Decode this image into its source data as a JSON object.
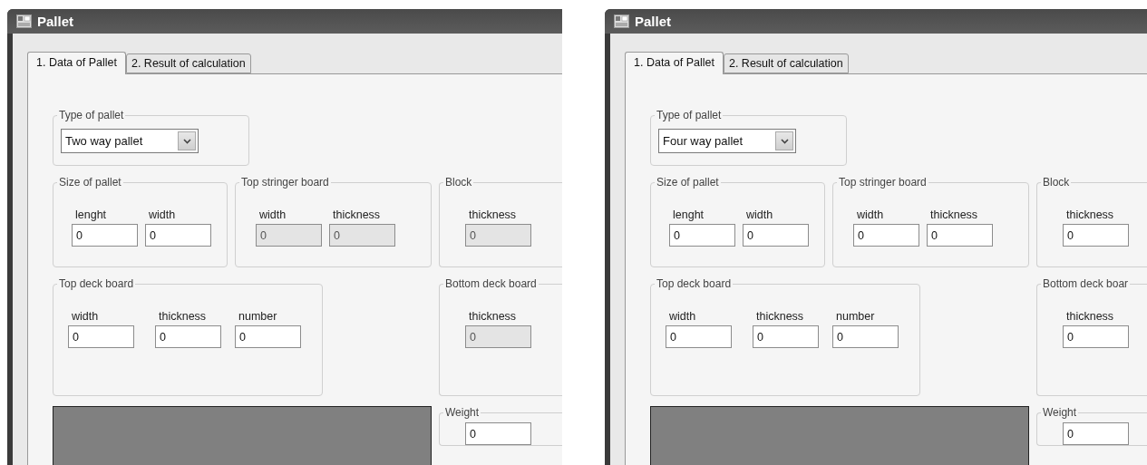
{
  "windows": [
    {
      "title": "Pallet",
      "tabs": [
        {
          "label": "1. Data of Pallet",
          "selected": true
        },
        {
          "label": "2. Result of calculation",
          "selected": false
        }
      ],
      "type_of_pallet": {
        "title": "Type of pallet",
        "value": "Two way pallet"
      },
      "size_of_pallet": {
        "title": "Size of pallet",
        "fields": [
          {
            "label": "lenght",
            "value": "0",
            "disabled": false
          },
          {
            "label": "width",
            "value": "0",
            "disabled": false
          }
        ]
      },
      "top_stringer_board": {
        "title": "Top stringer board",
        "fields": [
          {
            "label": "width",
            "value": "0",
            "disabled": true
          },
          {
            "label": "thickness",
            "value": "0",
            "disabled": true
          }
        ]
      },
      "block": {
        "title": "Block",
        "fields": [
          {
            "label": "thickness",
            "value": "0",
            "disabled": true
          }
        ]
      },
      "top_deck_board": {
        "title": "Top deck board",
        "fields": [
          {
            "label": "width",
            "value": "0",
            "disabled": false
          },
          {
            "label": "thickness",
            "value": "0",
            "disabled": false
          },
          {
            "label": "number",
            "value": "0",
            "disabled": false
          }
        ]
      },
      "bottom_deck_board": {
        "title": "Bottom deck board",
        "fields": [
          {
            "label": "thickness",
            "value": "0",
            "disabled": true
          }
        ]
      },
      "weight": {
        "title": "Weight",
        "value": "0"
      }
    },
    {
      "title": "Pallet",
      "tabs": [
        {
          "label": "1. Data of Pallet",
          "selected": true
        },
        {
          "label": "2. Result of calculation",
          "selected": false
        }
      ],
      "type_of_pallet": {
        "title": "Type of pallet",
        "value": "Four way pallet"
      },
      "size_of_pallet": {
        "title": "Size of pallet",
        "fields": [
          {
            "label": "lenght",
            "value": "0",
            "disabled": false
          },
          {
            "label": "width",
            "value": "0",
            "disabled": false
          }
        ]
      },
      "top_stringer_board": {
        "title": "Top stringer board",
        "fields": [
          {
            "label": "width",
            "value": "0",
            "disabled": false
          },
          {
            "label": "thickness",
            "value": "0",
            "disabled": false
          }
        ]
      },
      "block": {
        "title": "Block",
        "fields": [
          {
            "label": "thickness",
            "value": "0",
            "disabled": false
          }
        ]
      },
      "top_deck_board": {
        "title": "Top deck board",
        "fields": [
          {
            "label": "width",
            "value": "0",
            "disabled": false
          },
          {
            "label": "thickness",
            "value": "0",
            "disabled": false
          },
          {
            "label": "number",
            "value": "0",
            "disabled": false
          }
        ]
      },
      "bottom_deck_board": {
        "title": "Bottom deck boar",
        "fields": [
          {
            "label": "thickness",
            "value": "0",
            "disabled": false
          }
        ]
      },
      "weight": {
        "title": "Weight",
        "value": "0"
      }
    }
  ]
}
